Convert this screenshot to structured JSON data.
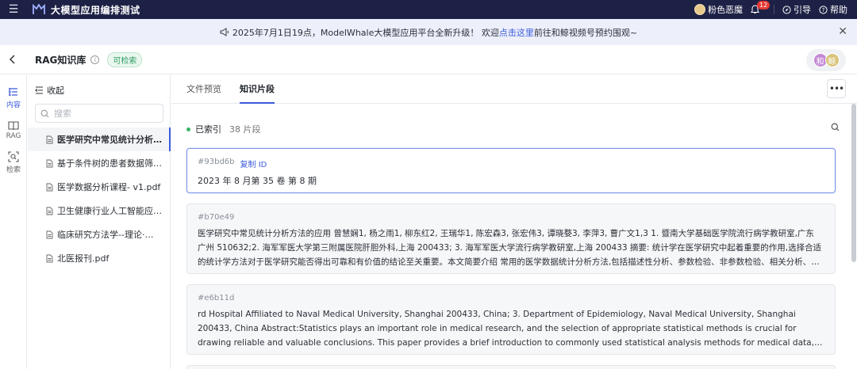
{
  "topbar": {
    "app_title": "大模型应用编排测试",
    "user_name": "粉色恶魔",
    "notification_count": "12",
    "guide_label": "引导",
    "help_label": "帮助"
  },
  "announcement": {
    "text_before": "2025年7月1日19点，ModelWhale大模型应用平台全新升级！ 欢迎",
    "link_text": "点击这里",
    "text_after": "前往和鲸视频号预约围观~"
  },
  "header": {
    "kb_name": "RAG知识库",
    "status_tag": "可检索",
    "avatars": [
      "和",
      "鲸"
    ]
  },
  "rail": {
    "items": [
      {
        "label": "内容",
        "icon": "content-icon"
      },
      {
        "label": "RAG",
        "icon": "book-icon"
      },
      {
        "label": "检索",
        "icon": "scan-icon"
      }
    ]
  },
  "sidebar": {
    "collapse_label": "收起",
    "search_placeholder": "搜索",
    "files": [
      "医学研究中常见统计分析方法的应用",
      "基于条件树的患者数据筛选方法研究",
      "医学数据分析课程- v1.pdf",
      "卫生健康行业人工智能应用场景参考",
      "临床研究方法学--理论·案例·实践",
      "北医报刊.pdf"
    ]
  },
  "main": {
    "tabs": [
      "文件预览",
      "知识片段"
    ],
    "index_status": "已索引",
    "segment_count": "38 片段",
    "copy_id_label": "复制 ID",
    "cards": [
      {
        "id": "#93bd6b",
        "text": "2023 年 8 月第 35 卷 第 8 期"
      },
      {
        "id": "#b70e49",
        "text": "医学研究中常见统计分析方法的应用 曾慧娴1, 杨之雨1, 柳东红2, 王瑞华1, 陈宏森3, 张宏伟3, 谭晓婺3, 李萍3, 曹广文1,3 1. 暨南大学基础医学院流行病学教研室,广东 广州 510632;2. 海军军医大学第三附属医院肝胆外科,上海 200433; 3. 海军军医大学流行病学教研室,上海 200433 摘要: 统计学在医学研究中起着重要的作用,选择合适的统计学方法对于医学研究能否得出可靠和有价值的结论至关重要。本文简要介绍 常用的医学数据统计分析方法,包括描述性分析、参数检验、非参数检验、相关分析、回归分析等"
      },
      {
        "id": "#e6b11d",
        "text": "rd Hospital Affiliated to Naval Medical University, Shanghai 200433, China; 3. Department of Epidemiology, Naval Medical University, Shanghai 200433, China Abstract:Statistics plays an important role in medical research, and the selection of appropriate statistical methods is crucial for drawing reliable and valuable conclusions. This paper provides a brief introduction to commonly used statistical analysis methods for medical data, covering descriptive analysis, parametric test, non-parametric test"
      }
    ]
  }
}
